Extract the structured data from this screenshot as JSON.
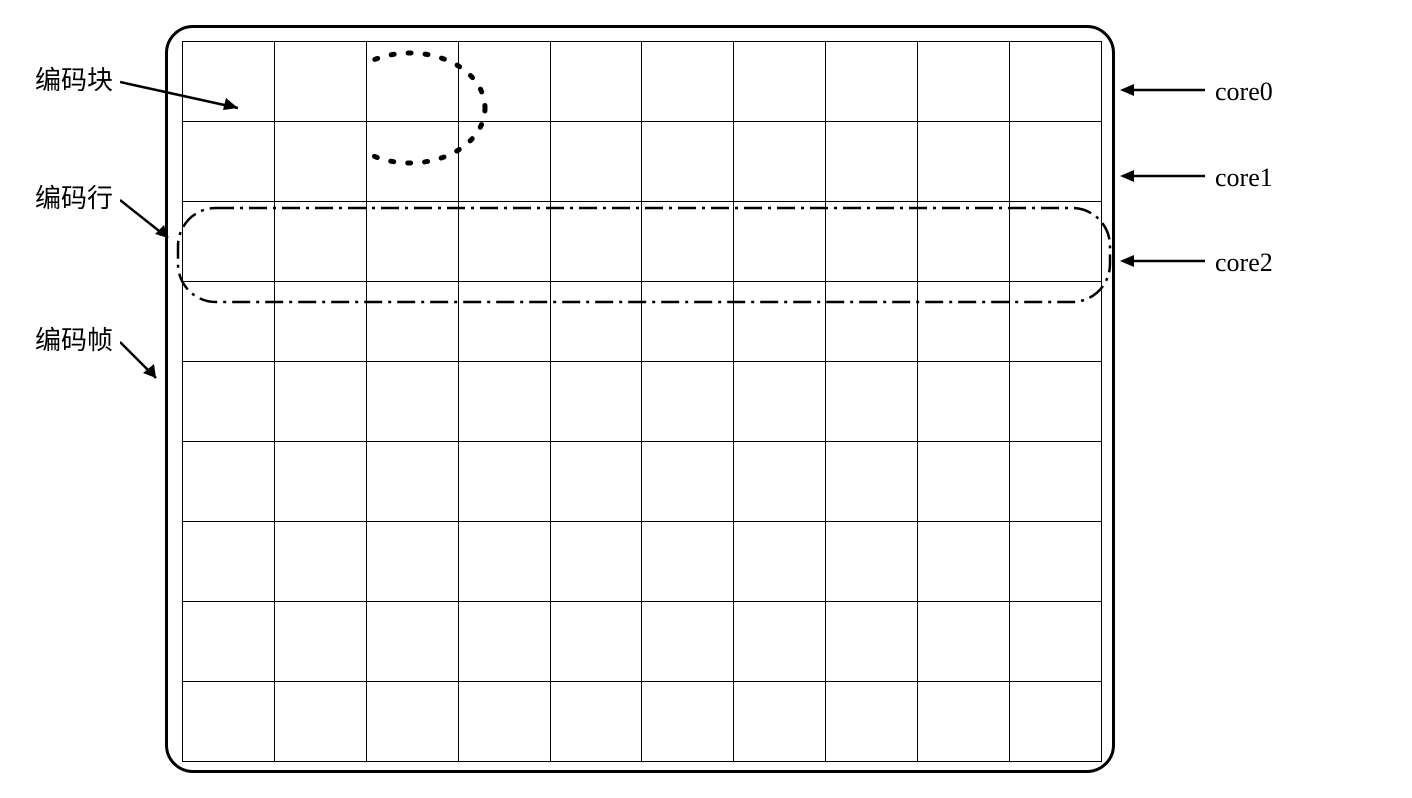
{
  "grid": {
    "rows": 9,
    "cols": 10
  },
  "labels": {
    "encoding_block": "编码块",
    "encoding_row": "编码行",
    "encoding_frame": "编码帧",
    "core0": "core0",
    "core1": "core1",
    "core2": "core2"
  },
  "annotations": {
    "dotted_circle": "highlights single encoding block (top-left 2x2 region)",
    "dash_dot_outline": "highlights single encoding row (row 3)",
    "rounded_frame": "represents encoding frame"
  }
}
